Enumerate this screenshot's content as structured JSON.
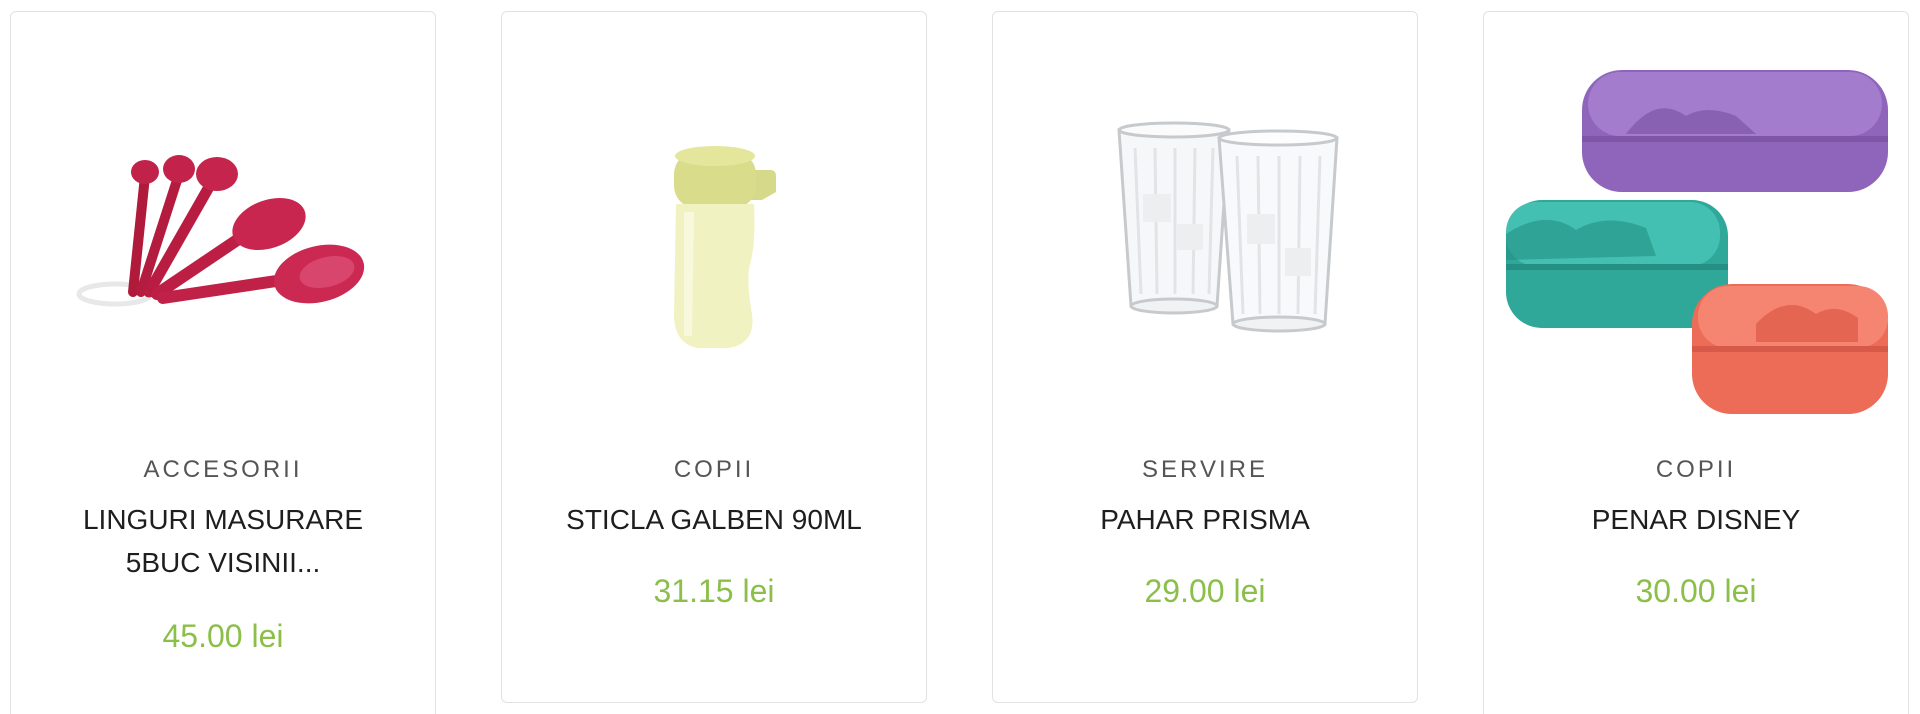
{
  "colors": {
    "price": "#8bbf4a",
    "category": "#555555",
    "name": "#1e1e1e",
    "border": "#e2e2e2"
  },
  "products": [
    {
      "category": "ACCESORII",
      "name": "LINGURI MASURARE 5BUC VISINII...",
      "price": "45.00 lei",
      "image": "red-measuring-spoons"
    },
    {
      "category": "COPII",
      "name": "STICLA GALBEN 90ML",
      "price": "31.15 lei",
      "image": "yellow-bottle"
    },
    {
      "category": "SERVIRE",
      "name": "PAHAR PRISMA",
      "price": "29.00 lei",
      "image": "glass-tumblers"
    },
    {
      "category": "COPII",
      "name": "PENAR DISNEY",
      "price": "30.00 lei",
      "image": "disney-pencil-cases"
    }
  ]
}
